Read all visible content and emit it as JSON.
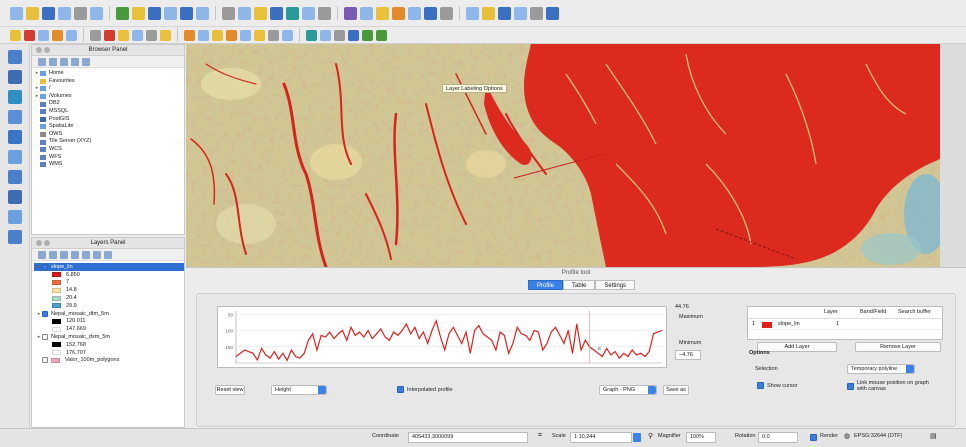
{
  "browser_panel": {
    "title": "Browser Panel",
    "items": [
      {
        "label": "Home",
        "level": 1,
        "expander": "▸",
        "icon_color": "#6a9fe0"
      },
      {
        "label": "Favourites",
        "level": 1,
        "expander": "",
        "icon_color": "#e8c03a"
      },
      {
        "label": "/",
        "level": 1,
        "expander": "▸",
        "icon_color": "#6a9fe0"
      },
      {
        "label": "/Volumes",
        "level": 1,
        "expander": "▸",
        "icon_color": "#6a9fe0"
      },
      {
        "label": "DB2",
        "level": 1,
        "expander": "",
        "icon_color": "#5b7fc0"
      },
      {
        "label": "MSSQL",
        "level": 1,
        "expander": "",
        "icon_color": "#5b7fc0"
      },
      {
        "label": "PostGIS",
        "level": 1,
        "expander": "",
        "icon_color": "#3d6aa8"
      },
      {
        "label": "SpatiaLite",
        "level": 1,
        "expander": "",
        "icon_color": "#6a9fe0"
      },
      {
        "label": "OWS",
        "level": 1,
        "expander": "",
        "icon_color": "#8a8a8a"
      },
      {
        "label": "Tile Server (XYZ)",
        "level": 1,
        "expander": "",
        "icon_color": "#5b7fc0"
      },
      {
        "label": "WCS",
        "level": 1,
        "expander": "",
        "icon_color": "#5b7fc0"
      },
      {
        "label": "WFS",
        "level": 1,
        "expander": "",
        "icon_color": "#5b7fc0"
      },
      {
        "label": "WMS",
        "level": 1,
        "expander": "",
        "icon_color": "#5b7fc0"
      }
    ]
  },
  "layers_panel": {
    "title": "Layers Panel",
    "rows": [
      {
        "label": "slope_lin",
        "checked": true,
        "swatch": "",
        "selected": true,
        "indent": 0,
        "expander": "▾"
      },
      {
        "label": "6.850",
        "checked": false,
        "swatch": "#d7191c",
        "selected": false,
        "indent": 2,
        "expander": ""
      },
      {
        "label": "7",
        "checked": false,
        "swatch": "#f06d3a",
        "selected": false,
        "indent": 2,
        "expander": ""
      },
      {
        "label": "14.8",
        "checked": false,
        "swatch": "#fde2a0",
        "selected": false,
        "indent": 2,
        "expander": ""
      },
      {
        "label": "20.4",
        "checked": false,
        "swatch": "#a8d9c9",
        "selected": false,
        "indent": 2,
        "expander": ""
      },
      {
        "label": "29.9",
        "checked": false,
        "swatch": "#4ea0cd",
        "selected": false,
        "indent": 2,
        "expander": ""
      },
      {
        "label": "Nepal_mosaic_dtm_5m",
        "checked": true,
        "swatch": "",
        "selected": false,
        "indent": 0,
        "expander": "▸"
      },
      {
        "label": "120.011",
        "checked": false,
        "swatch": "#000000",
        "selected": false,
        "indent": 2,
        "expander": ""
      },
      {
        "label": "147.669",
        "checked": false,
        "swatch": "#ffffff",
        "selected": false,
        "indent": 2,
        "expander": ""
      },
      {
        "label": "Nepal_mosaic_dsm_5m",
        "checked": false,
        "swatch": "",
        "selected": false,
        "indent": 0,
        "expander": "▸"
      },
      {
        "label": "152.768",
        "checked": false,
        "swatch": "#000000",
        "selected": false,
        "indent": 2,
        "expander": ""
      },
      {
        "label": "176.707",
        "checked": false,
        "swatch": "#ffffff",
        "selected": false,
        "indent": 2,
        "expander": ""
      },
      {
        "label": "Valor_100m_polygons",
        "checked": false,
        "swatch": "#f2a7b0",
        "selected": false,
        "indent": 0,
        "expander": ""
      }
    ]
  },
  "map": {
    "tooltip": "Layer Labeling Options"
  },
  "profile_tool": {
    "title": "Profile tool",
    "tabs": [
      {
        "label": "Profile",
        "active": true
      },
      {
        "label": "Table",
        "active": false
      },
      {
        "label": "Settings",
        "active": false
      }
    ],
    "y_ticks": [
      "150",
      "100",
      "50"
    ],
    "max_label": "Maximum",
    "max_value": "44.76",
    "min_label": "Minimum",
    "min_value": "−4.76",
    "reset_view_label": "Reset view",
    "height_select": "Height",
    "interpolated_label": "Interpolated profile",
    "export_select": "Graph - PNG",
    "save_label": "Save as",
    "table": {
      "headers": [
        "Layer",
        "Band/Field",
        "Search buffer"
      ],
      "row": {
        "index": "1",
        "layer": "slope_lin",
        "band": "1",
        "color": "#e0201b"
      }
    },
    "add_layer_label": "Add Layer",
    "remove_layer_label": "Remove Layer",
    "options_label": "Options",
    "selection_label": "Selection",
    "selection_value": "Temporary polyline",
    "show_cursor_label": "Show cursor",
    "link_label": "Link mouse position on graph with canvas",
    "plot_color": "#e0201b",
    "marker_label": "C"
  },
  "status": {
    "coordinate_label": "Coordinate",
    "coordinate_value": "405433,3000099",
    "scale_label": "Scale",
    "scale_value": "1:10,244",
    "magnifier_label": "Magnifier",
    "magnifier_value": "100%",
    "rotation_label": "Rotation",
    "rotation_value": "0.0",
    "render_label": "Render",
    "crs_label": "EPSG:32644 (OTF)"
  },
  "chart_data": {
    "type": "line",
    "x_range": [
      0,
      100
    ],
    "ylim": [
      0,
      160
    ],
    "y_ticks": [
      50,
      100,
      150
    ],
    "series": [
      {
        "x": [
          0,
          2,
          4,
          5,
          6,
          7,
          8,
          9,
          10,
          11,
          12,
          13,
          14,
          15,
          16,
          17,
          18,
          19,
          20,
          21,
          22,
          23,
          24,
          25,
          26,
          27,
          28,
          29,
          30,
          31,
          32,
          33,
          34,
          35,
          36,
          37,
          38,
          39,
          40,
          41,
          42,
          43,
          44,
          45,
          46,
          47,
          48,
          49,
          50,
          51,
          52,
          53,
          54,
          55,
          56,
          57,
          58,
          59,
          60,
          61,
          62,
          63,
          64,
          65,
          66,
          67,
          68,
          69,
          70,
          71,
          72,
          73,
          74,
          75,
          76,
          77,
          78,
          79,
          80,
          81,
          82,
          83,
          84,
          85,
          86,
          87,
          88,
          89,
          90,
          91,
          92,
          93,
          94,
          95,
          96,
          97,
          98,
          99,
          100
        ],
        "values": [
          20,
          40,
          30,
          10,
          45,
          25,
          15,
          35,
          12,
          30,
          8,
          40,
          20,
          15,
          30,
          70,
          90,
          40,
          85,
          80,
          95,
          75,
          90,
          100,
          70,
          110,
          85,
          95,
          80,
          100,
          75,
          90,
          105,
          80,
          70,
          95,
          85,
          100,
          120,
          90,
          110,
          75,
          95,
          60,
          100,
          130,
          80,
          40,
          90,
          110,
          85,
          60,
          95,
          30,
          100,
          115,
          90,
          80,
          70,
          40,
          95,
          85,
          30,
          60,
          110,
          90,
          85,
          70,
          100,
          95,
          40,
          60,
          95,
          110,
          85,
          60,
          100,
          30,
          120,
          40,
          70,
          50,
          40,
          30,
          20,
          45,
          25,
          35,
          15,
          30,
          20,
          40,
          25,
          30,
          20,
          35,
          90,
          95,
          100
        ]
      }
    ]
  }
}
